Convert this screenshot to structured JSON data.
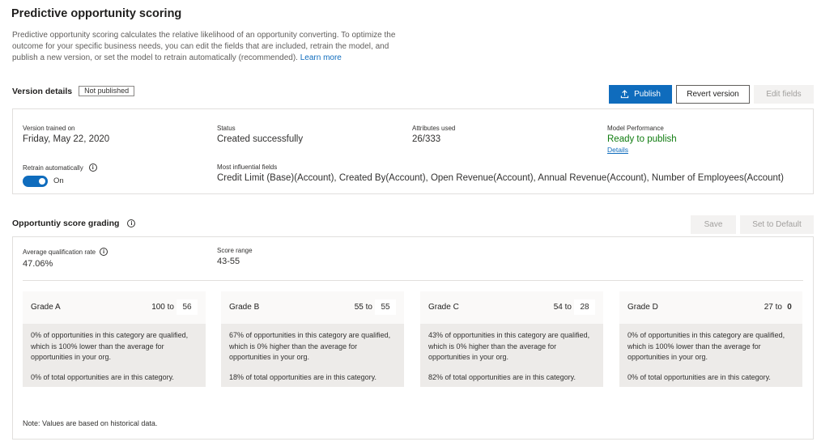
{
  "header": {
    "title": "Predictive opportunity scoring",
    "description": "Predictive opportunity scoring calculates the relative likelihood of an opportunity converting. To optimize the outcome for your specific business needs, you can edit the fields that are included, retrain the model, and publish a new version, or set the model to retrain automatically (recommended).",
    "learn_more": "Learn more"
  },
  "version": {
    "section_title": "Version details",
    "status_badge": "Not published",
    "buttons": {
      "publish": "Publish",
      "revert": "Revert version",
      "edit_fields": "Edit fields"
    },
    "trained_on_label": "Version trained on",
    "trained_on_value": "Friday, May 22, 2020",
    "status_label": "Status",
    "status_value": "Created successfully",
    "attributes_label": "Attributes used",
    "attributes_value": "26/333",
    "performance_label": "Model Performance",
    "performance_value": "Ready to publish",
    "details_link": "Details",
    "retrain_label": "Retrain automatically",
    "retrain_state": "On",
    "influential_label": "Most influential fields",
    "influential_value": "Credit Limit (Base)(Account), Created By(Account), Open Revenue(Account), Annual Revenue(Account), Number of Employees(Account)"
  },
  "grading": {
    "section_title": "Opportuntiy score grading",
    "buttons": {
      "save": "Save",
      "set_default": "Set to Default"
    },
    "avg_rate_label": "Average qualification rate",
    "avg_rate_value": "47.06%",
    "score_range_label": "Score range",
    "score_range_value": "43-55",
    "grades": [
      {
        "name": "Grade A",
        "from": "100 to",
        "to": "56",
        "qualified_text": "0% of opportunities in this category are qualified, which is 100% lower than the average for opportunities in your org.",
        "total_text": "0% of total opportunities are in this category."
      },
      {
        "name": "Grade B",
        "from": "55 to",
        "to": "55",
        "qualified_text": "67% of opportunities in this category are qualified, which is 0% higher than the average for opportunities in your org.",
        "total_text": "18% of total opportunities are in this category."
      },
      {
        "name": "Grade C",
        "from": "54 to",
        "to": "28",
        "qualified_text": "43% of opportunities in this category are qualified, which is 0% higher than the average for opportunities in your org.",
        "total_text": "82% of total opportunities are in this category."
      },
      {
        "name": "Grade D",
        "from": "27 to",
        "to": "0",
        "qualified_text": "0% of opportunities in this category are qualified, which is 100% lower than the average for opportunities in your org.",
        "total_text": "0% of total opportunities are in this category."
      }
    ],
    "note": "Note: Values are based on historical data."
  },
  "colors": {
    "accent": "#0f6cbd",
    "success": "#107c10",
    "disabled_bg": "#f3f2f1",
    "grade_body_bg": "#edebe9"
  },
  "icons": {
    "publish": "upload-icon",
    "info": "info-icon"
  }
}
